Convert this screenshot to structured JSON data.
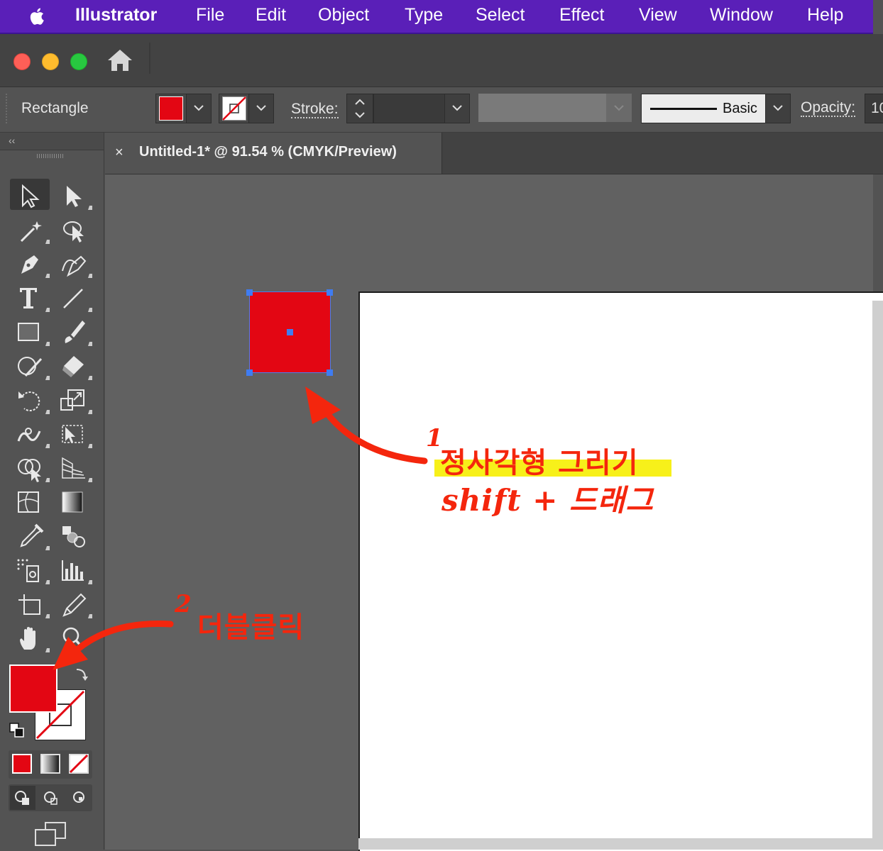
{
  "menubar": {
    "app_name": "Illustrator",
    "items": [
      "File",
      "Edit",
      "Object",
      "Type",
      "Select",
      "Effect",
      "View",
      "Window",
      "Help"
    ],
    "background": "#5a1fb8"
  },
  "control_bar": {
    "selection_label": "Rectangle",
    "fill_color": "#e30613",
    "stroke_color": "none",
    "stroke_label": "Stroke:",
    "brush_profile": "Basic",
    "opacity_label": "Opacity:",
    "opacity_value": "10"
  },
  "document_tab": {
    "close_glyph": "×",
    "title": "Untitled-1* @ 91.54 % (CMYK/Preview)"
  },
  "tools_panel": {
    "collapse_glyph": "‹‹",
    "tools": [
      "selection-tool",
      "direct-selection-tool",
      "magic-wand-tool",
      "lasso-tool",
      "pen-tool",
      "curvature-tool",
      "type-tool",
      "line-segment-tool",
      "rectangle-tool",
      "paintbrush-tool",
      "shaper-tool",
      "eraser-tool",
      "rotate-tool",
      "scale-tool",
      "warp-tool",
      "free-transform-tool",
      "shape-builder-tool",
      "perspective-grid-tool",
      "mesh-tool",
      "gradient-tool",
      "eyedropper-tool",
      "blend-tool",
      "symbol-sprayer-tool",
      "column-graph-tool",
      "artboard-tool",
      "slice-tool",
      "hand-tool",
      "zoom-tool"
    ],
    "fill_swatch": "#e30613",
    "stroke_swatch": "none"
  },
  "canvas": {
    "selected_object": "rectangle",
    "object_fill": "#e30613"
  },
  "annotations": {
    "step1_number": "1",
    "step1_line1": "정사각형 그리기",
    "step1_line2": "shift + 드래그",
    "step2_number": "2",
    "step2_text": "더블클릭",
    "color": "#f4260d",
    "highlight": "#f7f01a"
  }
}
